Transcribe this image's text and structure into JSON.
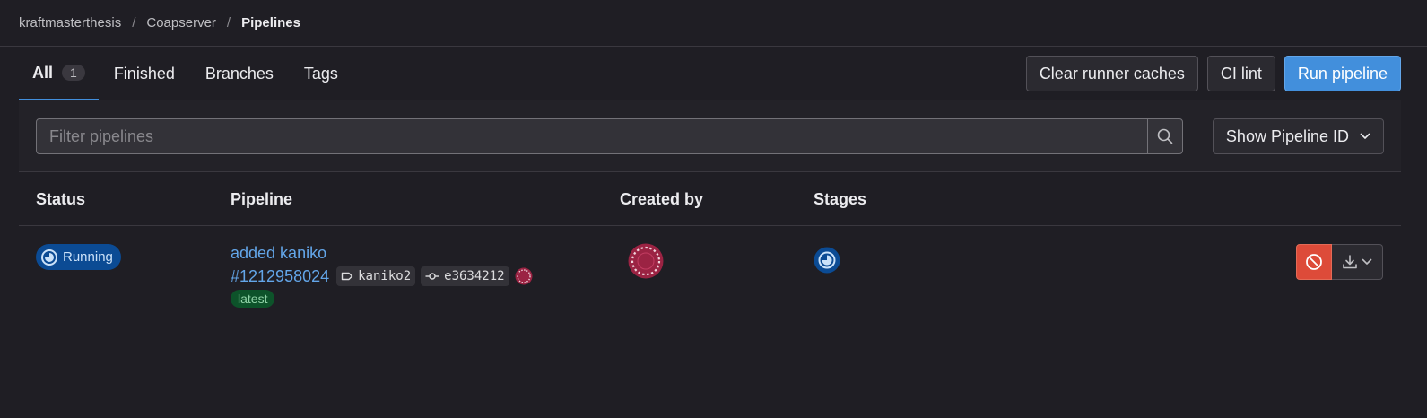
{
  "breadcrumb": {
    "items": [
      "kraftmasterthesis",
      "Coapserver",
      "Pipelines"
    ],
    "separator": "/"
  },
  "tabs": [
    {
      "label": "All",
      "count": "1",
      "active": true
    },
    {
      "label": "Finished"
    },
    {
      "label": "Branches"
    },
    {
      "label": "Tags"
    }
  ],
  "actions": {
    "clear_caches": "Clear runner caches",
    "ci_lint": "CI lint",
    "run_pipeline": "Run pipeline"
  },
  "filter": {
    "placeholder": "Filter pipelines",
    "dropdown_label": "Show Pipeline ID",
    "search_icon": "search-icon"
  },
  "table": {
    "headers": [
      "Status",
      "Pipeline",
      "Created by",
      "Stages"
    ],
    "rows": [
      {
        "status": "Running",
        "title": "added kaniko",
        "id": "#1212958024",
        "branch": "kaniko2",
        "commit": "e3634212",
        "badge": "latest",
        "stage_status": "running"
      }
    ]
  },
  "colors": {
    "accent": "#428fdc",
    "running": "#0b4b94",
    "success_badge": "#0d532a",
    "danger": "#dd4b39",
    "avatar": "#9b2343"
  }
}
